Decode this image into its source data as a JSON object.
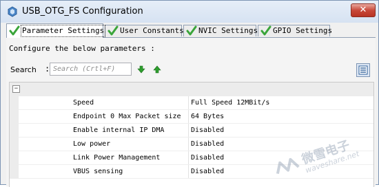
{
  "window": {
    "title": "USB_OTG_FS Configuration",
    "close_label": "✕"
  },
  "tabs": [
    {
      "label": "Parameter Settings",
      "active": true
    },
    {
      "label": "User Constants",
      "active": false
    },
    {
      "label": "NVIC Settings",
      "active": false
    },
    {
      "label": "GPIO Settings",
      "active": false
    }
  ],
  "panel": {
    "configure_text": "Configure the below parameters :",
    "search_label": "Search",
    "search_sep": ":",
    "search_placeholder": "Search (Crtl+F)"
  },
  "group": {
    "toggle": "−"
  },
  "params": [
    {
      "name": "Speed",
      "value": "Full Speed 12MBit/s"
    },
    {
      "name": "Endpoint 0 Max Packet size",
      "value": "64 Bytes"
    },
    {
      "name": "Enable internal IP DMA",
      "value": "Disabled"
    },
    {
      "name": "Low power",
      "value": "Disabled"
    },
    {
      "name": "Link Power Management",
      "value": "Disabled"
    },
    {
      "name": "VBUS sensing",
      "value": "Disabled"
    }
  ],
  "watermark": {
    "text_cn": "微雪电子",
    "text_en": "waveshare.net"
  },
  "colors": {
    "check": "#3aa53a",
    "arrow": "#2e9e2e",
    "close": "#c8493a"
  }
}
